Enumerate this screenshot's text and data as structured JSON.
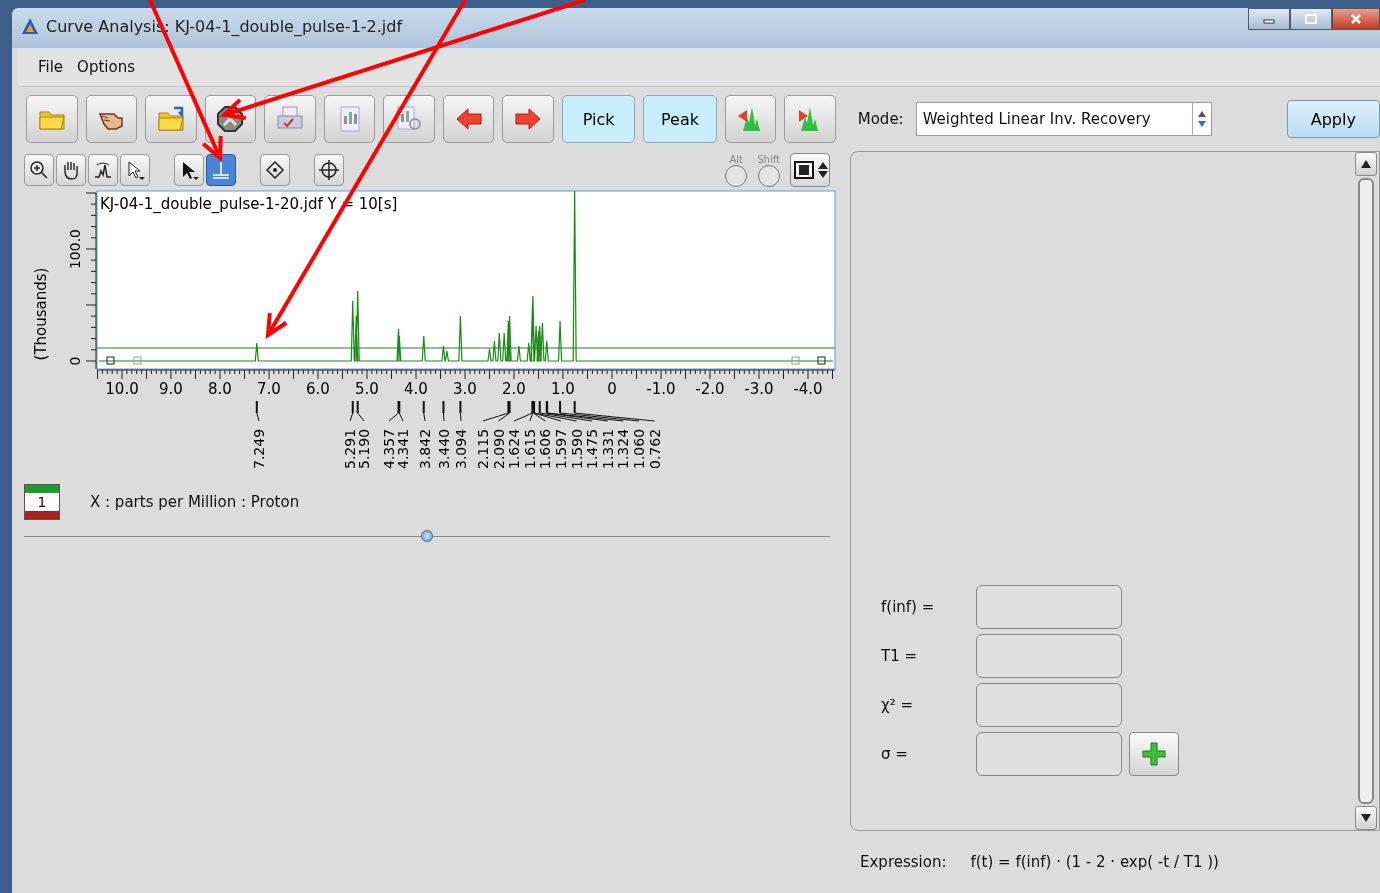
{
  "window": {
    "title": "Curve Analysis: KJ-04-1_double_pulse-1-2.jdf"
  },
  "menu": [
    "File",
    "Options"
  ],
  "toolbar": {
    "text_buttons": [
      {
        "label": "Pick",
        "selected": true
      },
      {
        "label": "Peak",
        "selected": true
      }
    ]
  },
  "tools": [
    {
      "selected": false
    },
    {
      "selected": false
    },
    {
      "selected": false
    },
    {
      "selected": false
    },
    {
      "selected": false
    },
    {
      "selected": true
    },
    {
      "selected": false
    },
    {
      "selected": false
    }
  ],
  "modifiers": [
    {
      "label": "Alt",
      "on": false
    },
    {
      "label": "Shift",
      "on": false
    }
  ],
  "mode": {
    "label": "Mode:",
    "value": "Weighted Linear Inv. Recovery"
  },
  "apply_button": "Apply",
  "spectrum": {
    "title": "KJ-04-1_double_pulse-1-20.jdf Y = 10[s]",
    "y_axis_label": "(Thousands)",
    "y_tick_labels": [
      "0",
      "100.0"
    ],
    "x_tick_labels": [
      "10.0",
      "9.0",
      "8.0",
      "7.0",
      "6.0",
      "5.0",
      "4.0",
      "3.0",
      "2.0",
      "1.0",
      "0",
      "-1.0",
      "-2.0",
      "-3.0",
      "-4.0"
    ],
    "peak_labels": [
      "7.249",
      "5.291",
      "5.190",
      "4.357",
      "4.341",
      "3.842",
      "3.440",
      "3.094",
      "2.115",
      "2.090",
      "1.624",
      "1.615",
      "1.606",
      "1.597",
      "1.590",
      "1.475",
      "1.331",
      "1.324",
      "1.060",
      "0.762"
    ]
  },
  "legend": {
    "label": "1",
    "axis_description": "X : parts per Million : Proton"
  },
  "slider": {
    "level": 0.5
  },
  "fit_fields": [
    {
      "label": "f(inf) ="
    },
    {
      "label": "T1 ="
    },
    {
      "label": "χ² ="
    },
    {
      "label": "σ ="
    }
  ],
  "expression": {
    "label": "Expression:",
    "value": "f(t) = f(inf) · (1 - 2 · exp( -t / T1 ))"
  }
}
